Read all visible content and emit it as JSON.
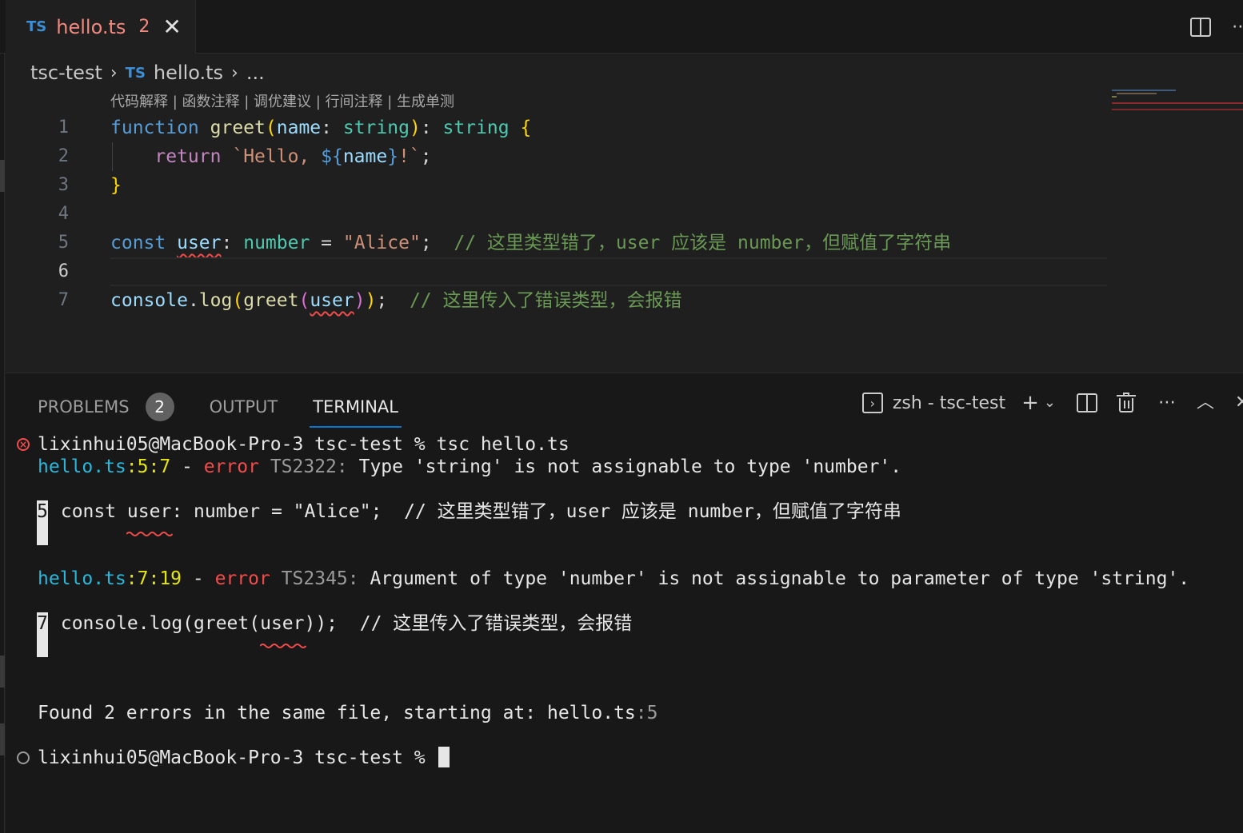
{
  "tab": {
    "badge": "TS",
    "filename": "hello.ts",
    "problem_count": "2",
    "close_glyph": "✕"
  },
  "breadcrumb": {
    "folder": "tsc-test",
    "badge": "TS",
    "file": "hello.ts",
    "tail": "..."
  },
  "codelens": "代码解释 | 函数注释 | 调优建议 | 行间注释 | 生成单测",
  "editor": {
    "line_numbers": [
      "1",
      "2",
      "3",
      "4",
      "5",
      "6",
      "7"
    ],
    "active_line": "6",
    "l1": {
      "kw": "function",
      "fn": "greet",
      "p_open": "(",
      "param": "name",
      "colon": ":",
      "type": "string",
      "p_close": ")",
      "colon2": ":",
      "rtype": "string",
      "brace": "{"
    },
    "l2": {
      "kw": "return",
      "str1": "`Hello, ",
      "interp_open": "${",
      "var": "name",
      "interp_close": "}",
      "str2": "!`",
      "semi": ";"
    },
    "l3": {
      "brace": "}"
    },
    "l5": {
      "kw": "const",
      "var": "user",
      "colon": ":",
      "type": "number",
      "eq": "=",
      "str": "\"Alice\"",
      "semi": ";",
      "comment": "// 这里类型错了，user 应该是 number，但赋值了字符串"
    },
    "l7": {
      "obj": "console",
      "dot": ".",
      "fn": "log",
      "p1": "(",
      "fn2": "greet",
      "p2": "(",
      "var": "user",
      "p2c": ")",
      "p1c": ")",
      "semi": ";",
      "comment": "// 这里传入了错误类型，会报错"
    }
  },
  "panel": {
    "tabs": {
      "problems": "PROBLEMS",
      "problems_count": "2",
      "output": "OUTPUT",
      "terminal": "TERMINAL"
    },
    "terminal_label": "zsh - tsc-test"
  },
  "terminal": {
    "prompt1": "lixinhui05@MacBook-Pro-3 tsc-test % tsc hello.ts",
    "err1": {
      "file": "hello.ts",
      "loc": ":5:7",
      "dash": " - ",
      "kind": "error",
      "code": " TS2322:",
      "msg": " Type 'string' is not assignable to type 'number'."
    },
    "snippet1": {
      "lineno": "5",
      "text": " const user: number = \"Alice\";  // 这里类型错了，user 应该是 number，但赋值了字符串"
    },
    "err2": {
      "file": "hello.ts",
      "loc": ":7:19",
      "dash": " - ",
      "kind": "error",
      "code": " TS2345:",
      "msg": " Argument of type 'number' is not assignable to parameter of type 'string'."
    },
    "snippet2": {
      "lineno": "7",
      "text": " console.log(greet(user));  // 这里传入了错误类型，会报错"
    },
    "found": {
      "text": "Found 2 errors in the same file, starting at: ",
      "file": "hello.ts",
      "loc": ":5"
    },
    "prompt2": "lixinhui05@MacBook-Pro-3 tsc-test % "
  },
  "colors": {
    "background": "#1f1f1f",
    "panel": "#181818",
    "error": "#f14c4c",
    "accent": "#0078d4",
    "ts_blue": "#3b8fd6"
  }
}
